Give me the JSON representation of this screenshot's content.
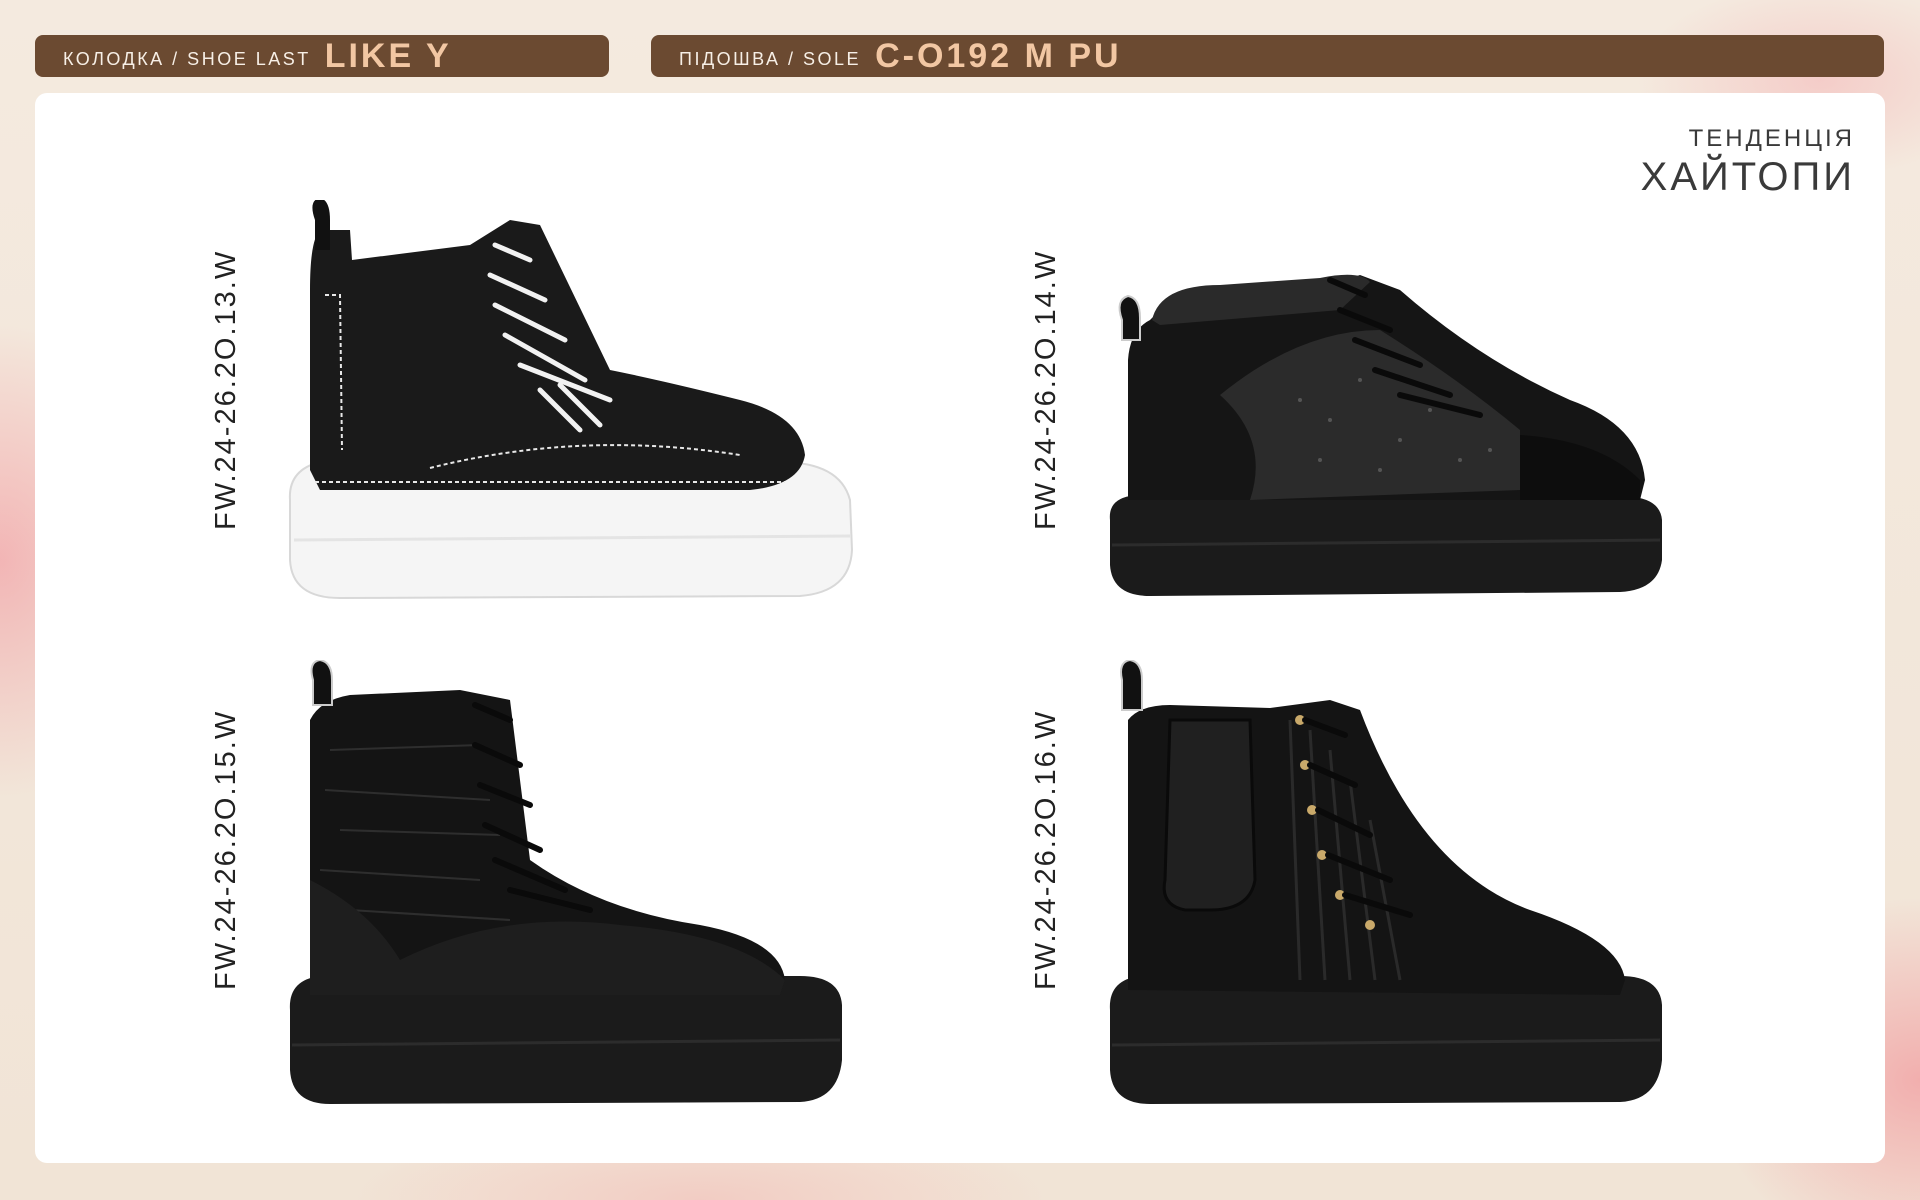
{
  "header": {
    "last_label": "КОЛОДКА / SHOE LAST",
    "last_value": "LIKE Y",
    "sole_label": "ПІДОШВА / SOLE",
    "sole_value": "C-O192 M PU"
  },
  "trend": {
    "subtitle": "ТЕНДЕНЦІЯ",
    "title": "ХАЙТОПИ"
  },
  "products": [
    {
      "code": "FW.24-26.2O.13.W",
      "image": "black-leather-high-top-sneaker-white-sole-white-laces"
    },
    {
      "code": "FW.24-26.2O.14.W",
      "image": "black-glitter-high-top-sneaker-fur-lining"
    },
    {
      "code": "FW.24-26.2O.15.W",
      "image": "black-crinkled-leather-lace-up-boot"
    },
    {
      "code": "FW.24-26.2O.16.W",
      "image": "black-quilted-leather-high-top-chelsea-panel"
    }
  ],
  "colors": {
    "header_bar": "#6b4a31",
    "header_value": "#f2c7a3",
    "page_bg": "#f3e8dc"
  }
}
